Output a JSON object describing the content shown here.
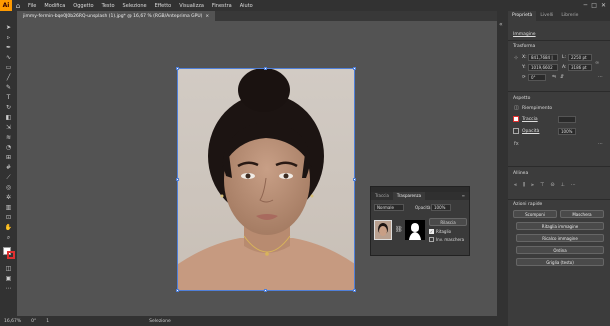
{
  "app": {
    "logo_text": "Ai"
  },
  "menu": [
    "File",
    "Modifica",
    "Oggetto",
    "Testo",
    "Selezione",
    "Effetto",
    "Visualizza",
    "Finestra",
    "Aiuto"
  ],
  "document_tab": {
    "title": "jimmy-fermin-bqe0J0b26RQ-unsplash (1).jpg* @ 16,67 % (RGB/Anteprima GPU)",
    "close": "×"
  },
  "status": {
    "zoom": "16,67%",
    "angle": "0°",
    "artboard": "1",
    "tool": "Selezione"
  },
  "right_panel": {
    "tabs": [
      "Proprietà",
      "Livelli",
      "Librerie"
    ],
    "object_type": "Immagine",
    "transform_label": "Trasforma",
    "x_label": "X:",
    "x_value": "841,7684 |",
    "y_label": "Y:",
    "y_value": "1019,6602",
    "w_label": "L:",
    "w_value": "2250 pt",
    "h_label": "A:",
    "h_value": "3186 pt",
    "rotation": "0°",
    "appearance_label": "Aspetto",
    "fill_label": "Riempimento",
    "stroke_label": "Traccia",
    "opacity_label": "Opacità",
    "opacity_value": "100%",
    "align_label": "Allinea",
    "quick_actions_label": "Azioni rapide",
    "btn_scomponi": "Scomponi",
    "btn_maschera": "Maschera",
    "btn_ritaglia": "Ritaglia immagine",
    "btn_ricalco": "Ricalco immagine",
    "btn_ordina": "Ordina",
    "btn_griglia": "Griglia (testo)"
  },
  "transparency_panel": {
    "tabs": [
      "Traccia",
      "Trasparenza"
    ],
    "blend_mode": "Normale",
    "opacity_label": "Opacità:",
    "opacity_value": "100%",
    "release_button": "Rilascia",
    "clip_label": "Ritaglio",
    "invert_label": "Inv. maschera"
  },
  "colors": {
    "accent": "#4f7fd8",
    "brand": "#ff9a00"
  }
}
